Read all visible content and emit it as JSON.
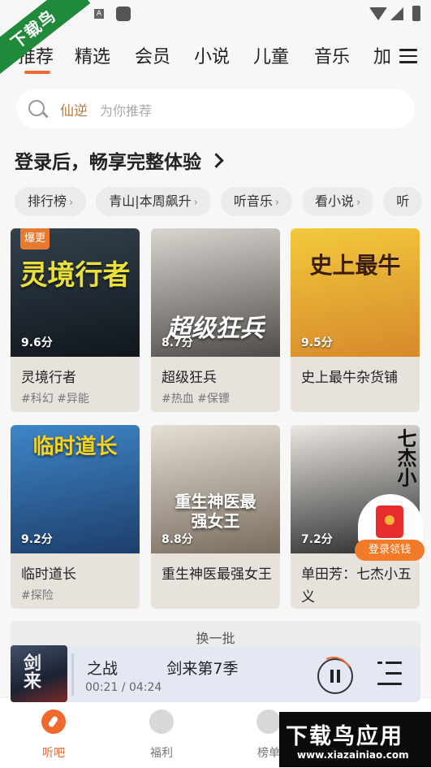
{
  "status_bar": {
    "icons": [
      "app-icon",
      "a-icon",
      "square-icon",
      "wifi-icon",
      "signal-icon",
      "battery-icon"
    ],
    "a_letter": "A"
  },
  "watermark_corner": "下载鸟",
  "tabs": {
    "items": [
      {
        "label": "推荐",
        "active": true
      },
      {
        "label": "精选"
      },
      {
        "label": "会员"
      },
      {
        "label": "小说"
      },
      {
        "label": "儿童"
      },
      {
        "label": "音乐"
      },
      {
        "label": "加"
      }
    ]
  },
  "search": {
    "keyword": "仙逆",
    "placeholder": "为你推荐"
  },
  "login_prompt": "登录后，畅享完整体验",
  "chips": [
    {
      "label": "排行榜"
    },
    {
      "label": "青山|本周飙升"
    },
    {
      "label": "听音乐"
    },
    {
      "label": "看小说"
    },
    {
      "label": "听"
    }
  ],
  "chip_arrow": "›",
  "books": [
    {
      "title": "灵境行者",
      "cover_text": "灵境行者",
      "score": "9.6分",
      "tags": "#科幻  #异能",
      "badge": "爆更",
      "colors": [
        "#33414d",
        "#10161c"
      ],
      "accent": "#e9e03b"
    },
    {
      "title": "超级狂兵",
      "cover_text": "超级狂兵",
      "score": "8.7分",
      "tags": "#热血  #保镖",
      "colors": [
        "#d9d6d0",
        "#4e4a47"
      ],
      "accent": "#ffffff"
    },
    {
      "title": "史上最牛杂货铺",
      "cover_text": "史上最牛",
      "score": "9.5分",
      "tags": "",
      "colors": [
        "#f3c93c",
        "#d6892b"
      ],
      "accent": "#3a1f10"
    },
    {
      "title": "临时道长",
      "cover_text": "临时道长",
      "score": "9.2分",
      "tags": "#探险",
      "colors": [
        "#3e86c8",
        "#1d3e6b"
      ],
      "accent": "#f6d321"
    },
    {
      "title": "重生神医最强女王",
      "cover_text": "重生神医最强女王",
      "score": "8.8分",
      "tags": "",
      "colors": [
        "#e4dfd5",
        "#7a6c5e"
      ],
      "accent": "#ffffff"
    },
    {
      "title": "单田芳：七杰小五义",
      "cover_text": "七杰小",
      "score": "7.2分",
      "tags": "",
      "colors": [
        "#ece8e3",
        "#2b2b2b"
      ],
      "accent": "#111111"
    }
  ],
  "reward": {
    "label": "登录领钱"
  },
  "refresh": {
    "label": "换一批"
  },
  "player": {
    "cover_text": "剑来",
    "title": "之战          剑来第7季",
    "time": "00:21 / 04:24"
  },
  "bottom_nav": [
    {
      "label": "听吧",
      "active": true
    },
    {
      "label": "福利"
    },
    {
      "label": "榜单"
    }
  ],
  "watermark": {
    "big": "下载鸟应用",
    "small": "www.xiazainiao.com"
  }
}
